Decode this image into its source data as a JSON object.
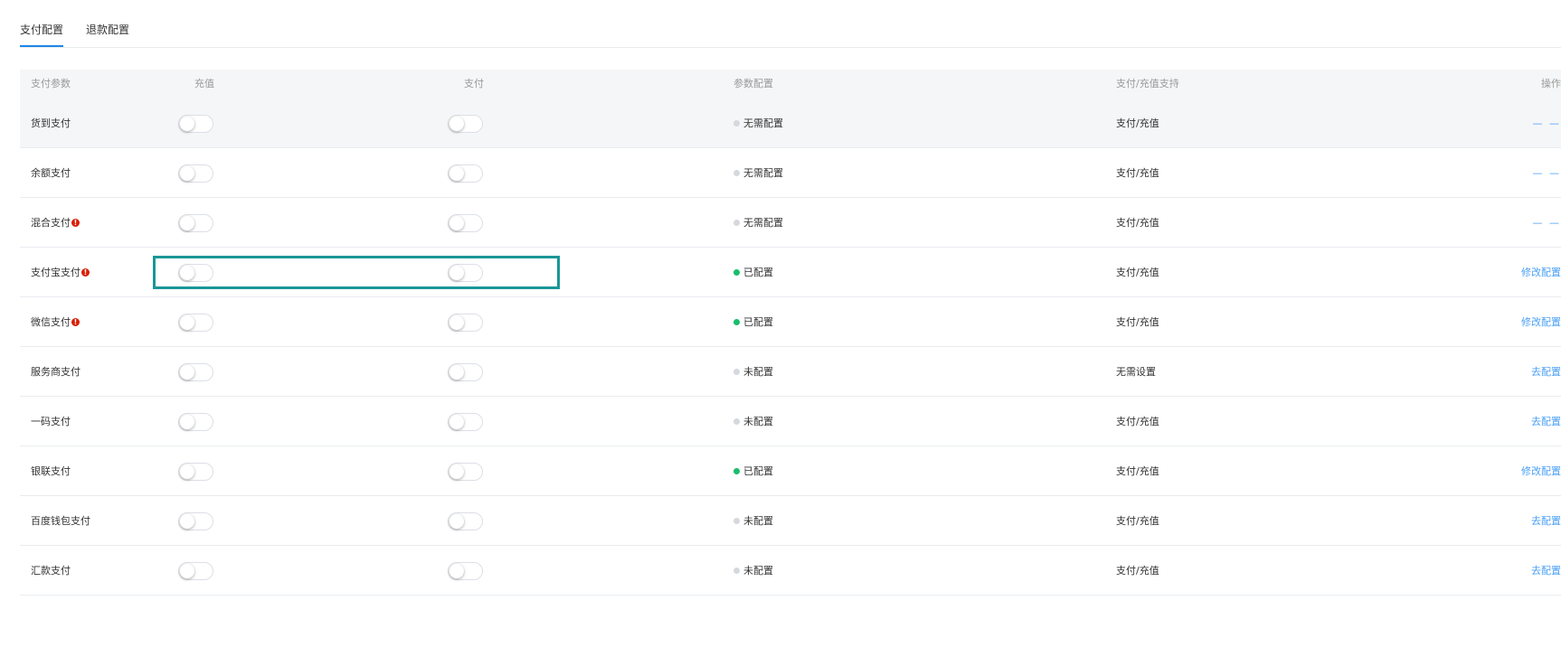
{
  "tabs": [
    {
      "label": "支付配置",
      "active": true
    },
    {
      "label": "退款配置",
      "active": false
    }
  ],
  "table": {
    "headers": [
      "支付参数",
      "充值",
      "支付",
      "参数配置",
      "支付/充值支持",
      "操作"
    ],
    "rows": [
      {
        "name": "货到支付",
        "warning": false,
        "recharge_on": false,
        "pay_on": false,
        "config_status": "无需配置",
        "status_color": "grey",
        "support": "支付/充值",
        "action": "— —"
      },
      {
        "name": "余额支付",
        "warning": false,
        "recharge_on": false,
        "pay_on": false,
        "config_status": "无需配置",
        "status_color": "grey",
        "support": "支付/充值",
        "action": "— —"
      },
      {
        "name": "混合支付",
        "warning": true,
        "recharge_on": false,
        "pay_on": false,
        "config_status": "无需配置",
        "status_color": "grey",
        "support": "支付/充值",
        "action": "— —"
      },
      {
        "name": "支付宝支付",
        "warning": true,
        "recharge_on": false,
        "pay_on": false,
        "config_status": "已配置",
        "status_color": "green",
        "support": "支付/充值",
        "action": "修改配置"
      },
      {
        "name": "微信支付",
        "warning": true,
        "recharge_on": false,
        "pay_on": false,
        "config_status": "已配置",
        "status_color": "green",
        "support": "支付/充值",
        "action": "修改配置"
      },
      {
        "name": "服务商支付",
        "warning": false,
        "recharge_on": false,
        "pay_on": false,
        "config_status": "未配置",
        "status_color": "grey",
        "support": "无需设置",
        "action": "去配置"
      },
      {
        "name": "一码支付",
        "warning": false,
        "recharge_on": false,
        "pay_on": false,
        "config_status": "未配置",
        "status_color": "grey",
        "support": "支付/充值",
        "action": "去配置"
      },
      {
        "name": "银联支付",
        "warning": false,
        "recharge_on": false,
        "pay_on": false,
        "config_status": "已配置",
        "status_color": "green",
        "support": "支付/充值",
        "action": "修改配置"
      },
      {
        "name": "百度钱包支付",
        "warning": false,
        "recharge_on": false,
        "pay_on": false,
        "config_status": "未配置",
        "status_color": "grey",
        "support": "支付/充值",
        "action": "去配置"
      },
      {
        "name": "汇款支付",
        "warning": false,
        "recharge_on": false,
        "pay_on": false,
        "config_status": "未配置",
        "status_color": "grey",
        "support": "支付/充值",
        "action": "去配置"
      }
    ]
  },
  "colors": {
    "accent": "#1e88e5",
    "link": "#4a9ff5",
    "configured": "#19be6b",
    "not_configured": "#d5d9de",
    "warning": "#d81e06",
    "highlight": "#1a9696"
  },
  "icons": {
    "warning": "exclamation-circle-icon"
  }
}
